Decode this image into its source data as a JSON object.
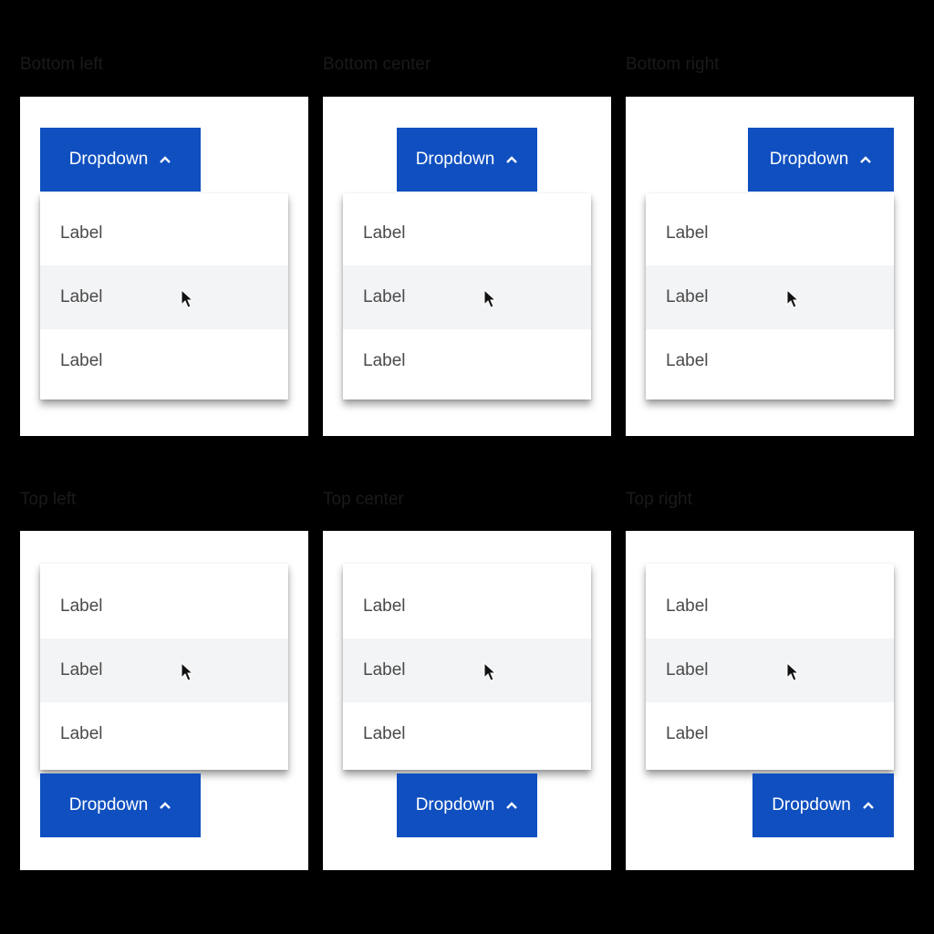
{
  "button_color": "#0f4fc0",
  "hover_row_color": "#f3f4f6",
  "sections": [
    {
      "title": "Bottom left",
      "button_label": "Dropdown",
      "items": [
        "Label",
        "Label",
        "Label"
      ],
      "placement": "bottom-left"
    },
    {
      "title": "Bottom center",
      "button_label": "Dropdown",
      "items": [
        "Label",
        "Label",
        "Label"
      ],
      "placement": "bottom-center"
    },
    {
      "title": "Bottom right",
      "button_label": "Dropdown",
      "items": [
        "Label",
        "Label",
        "Label"
      ],
      "placement": "bottom-right"
    },
    {
      "title": "Top left",
      "button_label": "Dropdown",
      "items": [
        "Label",
        "Label",
        "Label"
      ],
      "placement": "top-left"
    },
    {
      "title": "Top center",
      "button_label": "Dropdown",
      "items": [
        "Label",
        "Label",
        "Label"
      ],
      "placement": "top-center"
    },
    {
      "title": "Top right",
      "button_label": "Dropdown",
      "items": [
        "Label",
        "Label",
        "Label"
      ],
      "placement": "top-right"
    }
  ],
  "icons": {
    "chevron": "chevron-up-icon",
    "cursor": "mouse-pointer-icon"
  }
}
